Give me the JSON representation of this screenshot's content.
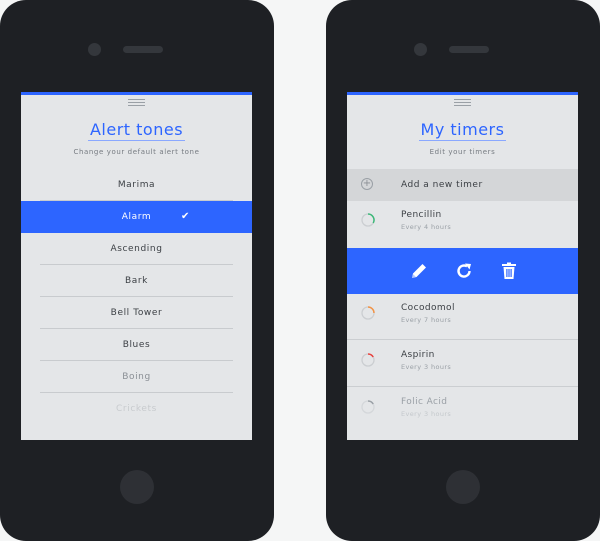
{
  "left_screen": {
    "title": "Alert tones",
    "subtitle": "Change your default alert tone",
    "tones": [
      {
        "label": "Marima",
        "selected": false
      },
      {
        "label": "Alarm",
        "selected": true
      },
      {
        "label": "Ascending",
        "selected": false
      },
      {
        "label": "Bark",
        "selected": false
      },
      {
        "label": "Bell Tower",
        "selected": false
      },
      {
        "label": "Blues",
        "selected": false
      },
      {
        "label": "Boing",
        "selected": false
      },
      {
        "label": "Crickets",
        "selected": false
      }
    ],
    "check_icon": "check-icon"
  },
  "right_screen": {
    "title": "My timers",
    "subtitle": "Edit your timers",
    "add_label": "Add a new timer",
    "timers": [
      {
        "name": "Pencillin",
        "frequency": "Every 4 hours",
        "color": "#3cb878"
      },
      {
        "name": "Cocodomol",
        "frequency": "Every 7 hours",
        "color": "#f29447"
      },
      {
        "name": "Aspirin",
        "frequency": "Every 3 hours",
        "color": "#e8403c"
      },
      {
        "name": "Folic Acid",
        "frequency": "Every 3 hours",
        "color": "#9aa0a6"
      }
    ],
    "actions": [
      "pencil-icon",
      "refresh-icon",
      "trash-icon"
    ]
  },
  "colors": {
    "accent": "#2d65ff",
    "screen_bg": "#e4e6e8",
    "device": "#1e2024"
  }
}
